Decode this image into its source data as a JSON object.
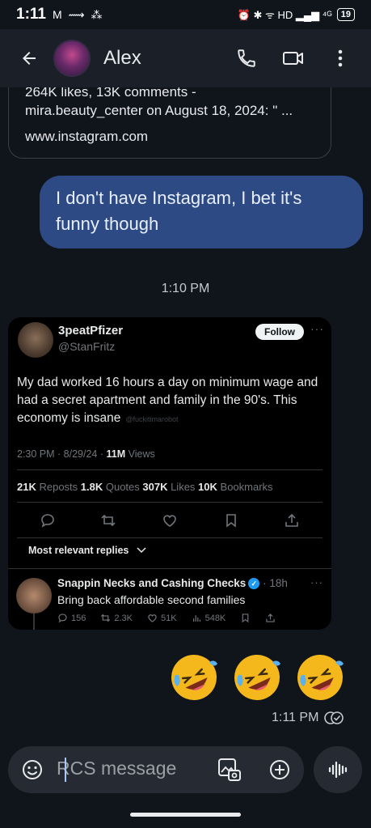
{
  "status_bar": {
    "time": "1:11",
    "left_icons": "M ⟿ ⁂",
    "right_icons": "⏰ ✱ ᯤ HD ▂▄▆ ⁴ᴳ",
    "battery": "19"
  },
  "header": {
    "contact_name": "Alex"
  },
  "link_preview": {
    "clipped_line": "264K likes, 13K comments -",
    "line2": "mira.beauty_center on August 18, 2024: \" ...",
    "domain": "www.instagram.com"
  },
  "messages": {
    "outgoing_text": "I don't have Instagram, I bet it's funny though",
    "timestamp_1": "1:10 PM",
    "sent_time": "1:11 PM"
  },
  "tweet": {
    "display_name": "3peatPfizer",
    "handle": "@StanFritz",
    "follow_label": "Follow",
    "more": "···",
    "text": "My dad worked 16 hours a day on minimum wage and had a secret apartment and family in the 90's. This economy is insane",
    "watermark": "@fuckitimarobot",
    "meta_time": "2:30 PM · 8/29/24 · ",
    "meta_views_count": "11M",
    "meta_views_label": " Views",
    "reposts_count": "21K",
    "reposts_label": " Reposts  ",
    "quotes_count": "1.8K",
    "quotes_label": " Quotes  ",
    "likes_count": "307K",
    "likes_label": " Likes  ",
    "bookmarks_count": "10K",
    "bookmarks_label": " Bookmarks",
    "replies_filter": "Most relevant replies",
    "reply": {
      "name": "Snappin Necks and Cashing Checks",
      "time": " · 18h",
      "text": "Bring back affordable second families",
      "replies": "156",
      "reposts": "2.3K",
      "likes": "51K",
      "views": "548K"
    }
  },
  "composer": {
    "placeholder": "RCS message"
  },
  "colors": {
    "background": "#10141b",
    "outgoing_bubble": "#2e4a85",
    "composer": "#262b33",
    "accent": "#a8c7fa"
  },
  "icons": [
    "back-arrow-icon",
    "phone-icon",
    "video-icon",
    "more-vert-icon",
    "emoji-icon",
    "add-media-icon",
    "plus-icon",
    "voice-icon",
    "read-receipt-icon"
  ]
}
